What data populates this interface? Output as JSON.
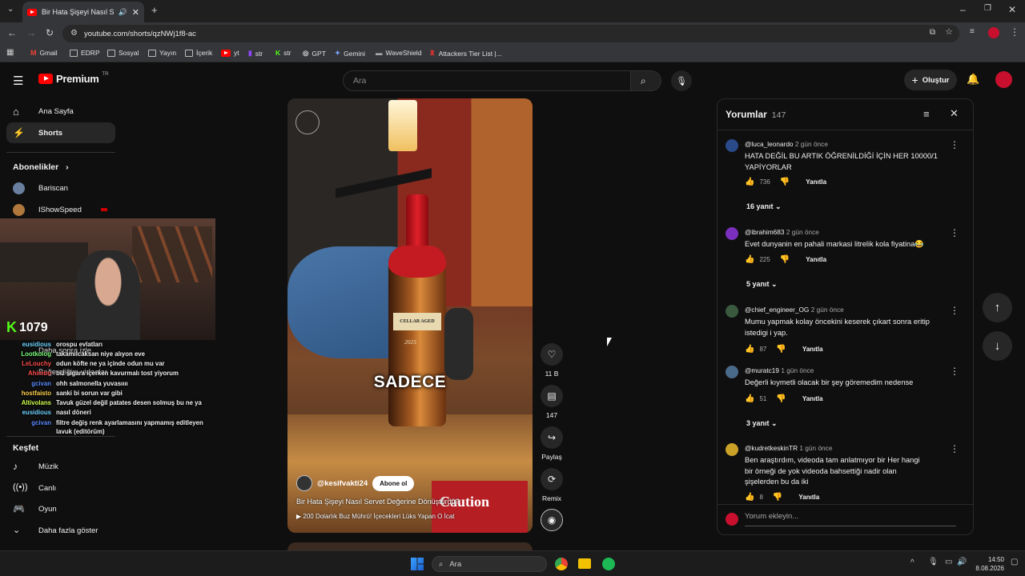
{
  "browser": {
    "tab_title": "Bir Hata Şişeyi Nasıl Servet",
    "url": "youtube.com/shorts/qzNWj1f8-ac",
    "bookmarks": [
      "Gmail",
      "EDRP",
      "Sosyal",
      "Yayın",
      "İçerik",
      "yt",
      "str",
      "str",
      "GPT",
      "Gemini",
      "WaveShield",
      "Attackers Tier List |..."
    ]
  },
  "header": {
    "logo": "Premium",
    "logo_region": "TR",
    "search_placeholder": "Ara",
    "create_label": "Oluştur"
  },
  "sidebar": {
    "home": "Ana Sayfa",
    "shorts": "Shorts",
    "subscriptions_title": "Abonelikler",
    "subs": [
      "Bariscan",
      "IShowSpeed"
    ],
    "hidden_items": [
      "Daha sonra izle",
      "Beğendiğim videolar"
    ],
    "explore_title": "Keşfet",
    "explore": [
      "Müzik",
      "Canlı",
      "Oyun"
    ],
    "show_more": "Daha fazla göster"
  },
  "stream_overlay": {
    "kick_count": "1079",
    "chat": [
      {
        "name": "eusidious",
        "msg": "orospu evlatları",
        "color": "#6fd3ff"
      },
      {
        "name": "Lootkolog",
        "msg": "takamılcaksan niye alıyon eve",
        "color": "#7cff7c"
      },
      {
        "name": "LeLouchy",
        "msg": "odun köfte ne ya içinde odun mu var",
        "color": "#ff4d4d"
      },
      {
        "name": "Ahimbo",
        "msg": "biz sigara içerken kavurmalı tost yiyorum",
        "color": "#ff4d4d"
      },
      {
        "name": "gcivan",
        "msg": "ohh salmonella yuvasıııı",
        "color": "#5b8cff"
      },
      {
        "name": "hostfaisto",
        "msg": "sanki bi sorun var gibi",
        "color": "#ffd24d"
      },
      {
        "name": "Altivolans",
        "msg": "Tavuk güzel değil patates desen solmuş bu ne ya",
        "color": "#d0ff4d"
      },
      {
        "name": "eusidious",
        "msg": "nasıl döneri",
        "color": "#6fd3ff"
      },
      {
        "name": "gcivan",
        "msg": "filtre değiş renk ayarlamasını yapmamış editleyen lavuk (editörüm)",
        "color": "#5b8cff"
      }
    ]
  },
  "short": {
    "caption_word": "SADECE",
    "channel": "@kesifvakti24",
    "subscribe": "Abone ol",
    "title": "Bir Hata Şişeyi Nasıl Servet Değerine Dönüştürdü?",
    "link_text": "200 Dolarlık Buz Mührü! İçecekleri Lüks Yapan O İcat",
    "bottle_label": "CELLAR AGED",
    "bottle_year": "2025",
    "box_text": "Caution",
    "likes": "11 B",
    "comments": "147",
    "share": "Paylaş",
    "remix": "Remix"
  },
  "comments": {
    "title": "Yorumlar",
    "count": "147",
    "reply_label": "Yanıtla",
    "add_placeholder": "Yorum ekleyin...",
    "items": [
      {
        "user": "@luca_leonardo",
        "time": "2 gün önce",
        "text": "HATA DEĞİL BU ARTIK ÖĞRENİLDİĞİ İÇİN HER 10000/1 YAPİYORLAR",
        "likes": "736",
        "replies": "16 yanıt",
        "avatar": "#2a4a8a"
      },
      {
        "user": "@ibrahim683",
        "time": "2 gün önce",
        "text": "Evet dunyanin en pahali markasi litrelik kola fiyatina😂",
        "likes": "225",
        "replies": "5 yanıt",
        "avatar": "#7b2fbf"
      },
      {
        "user": "@chief_engineer_OG",
        "time": "2 gün önce",
        "text": "Mumu yapmak kolay öncekini keserek çıkart sonra eritip istedigi i yap.",
        "likes": "87",
        "replies": "",
        "avatar": "#3a5a40"
      },
      {
        "user": "@muratc19",
        "time": "1 gün önce",
        "text": "Değerli kıymetli olacak bir şey göremedim nedense",
        "likes": "51",
        "replies": "3 yanıt",
        "avatar": "#4a6a8a"
      },
      {
        "user": "@kudretkeskinTR",
        "time": "1 gün önce",
        "text": "Ben araştırdım, videoda tam anlatmıyor bir Her hangi bir örneği de yok videoda bahsettiği nadir olan şişelerden bu da iki",
        "likes": "8",
        "replies": "",
        "avatar": "#c9a227"
      }
    ]
  },
  "taskbar": {
    "search": "Ara",
    "time": "14:50",
    "date": "8.08.2026"
  }
}
